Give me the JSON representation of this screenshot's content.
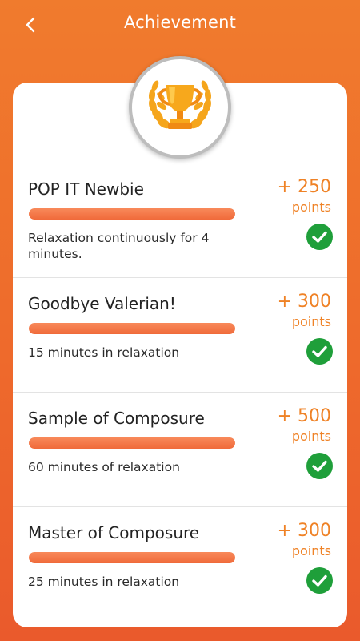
{
  "header": {
    "title": "Achievement",
    "back_icon": "chevron-left-icon"
  },
  "trophy": {
    "icon": "trophy-laurel-icon"
  },
  "achievements": [
    {
      "title": "POP IT Newbie",
      "progress_percent": 100,
      "description": "Relaxation continuously for 4 minutes.",
      "points": "+ 250",
      "points_unit": "points",
      "completed": true
    },
    {
      "title": "Goodbye Valerian!",
      "progress_percent": 100,
      "description": "15 minutes in relaxation",
      "points": "+ 300",
      "points_unit": "points",
      "completed": true
    },
    {
      "title": "Sample of Composure",
      "progress_percent": 100,
      "description": "60 minutes of relaxation",
      "points": "+ 500",
      "points_unit": "points",
      "completed": true
    },
    {
      "title": "Master of Composure",
      "progress_percent": 100,
      "description": "25 minutes in relaxation",
      "points": "+ 300",
      "points_unit": "points",
      "completed": true
    }
  ],
  "colors": {
    "background_top": "#f07b2d",
    "background_bottom": "#ea5a2c",
    "accent": "#ef8226",
    "progress": "#f06a3a",
    "check": "#1f9f3a"
  }
}
